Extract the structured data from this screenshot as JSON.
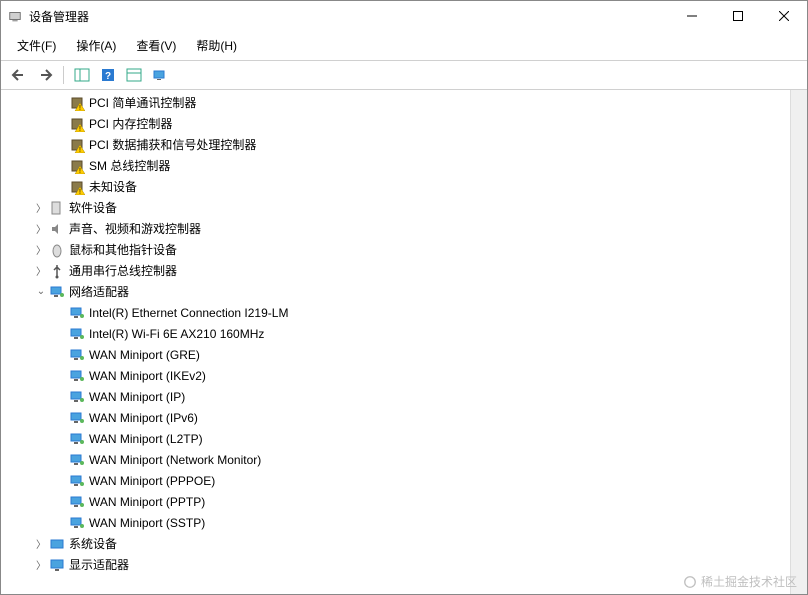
{
  "window": {
    "title": "设备管理器"
  },
  "menubar": {
    "file": "文件(F)",
    "action": "操作(A)",
    "view": "查看(V)",
    "help": "帮助(H)"
  },
  "tree": {
    "warning_items": [
      {
        "label": "PCI 简单通讯控制器",
        "icon": "chip-warning"
      },
      {
        "label": "PCI 内存控制器",
        "icon": "chip-warning"
      },
      {
        "label": "PCI 数据捕获和信号处理控制器",
        "icon": "chip-warning"
      },
      {
        "label": "SM 总线控制器",
        "icon": "chip-warning"
      },
      {
        "label": "未知设备",
        "icon": "chip-warning"
      }
    ],
    "categories": [
      {
        "label": "软件设备",
        "expanded": false,
        "icon": "software"
      },
      {
        "label": "声音、视频和游戏控制器",
        "expanded": false,
        "icon": "sound"
      },
      {
        "label": "鼠标和其他指针设备",
        "expanded": false,
        "icon": "mouse"
      },
      {
        "label": "通用串行总线控制器",
        "expanded": false,
        "icon": "usb"
      }
    ],
    "network": {
      "label": "网络适配器",
      "expanded": true,
      "items": [
        "Intel(R) Ethernet Connection I219-LM",
        "Intel(R) Wi-Fi 6E AX210 160MHz",
        "WAN Miniport (GRE)",
        "WAN Miniport (IKEv2)",
        "WAN Miniport (IP)",
        "WAN Miniport (IPv6)",
        "WAN Miniport (L2TP)",
        "WAN Miniport (Network Monitor)",
        "WAN Miniport (PPPOE)",
        "WAN Miniport (PPTP)",
        "WAN Miniport (SSTP)"
      ]
    },
    "tail_categories": [
      {
        "label": "系统设备",
        "expanded": false,
        "icon": "system"
      },
      {
        "label": "显示适配器",
        "expanded": false,
        "icon": "display"
      }
    ]
  },
  "watermark": "稀土掘金技术社区"
}
